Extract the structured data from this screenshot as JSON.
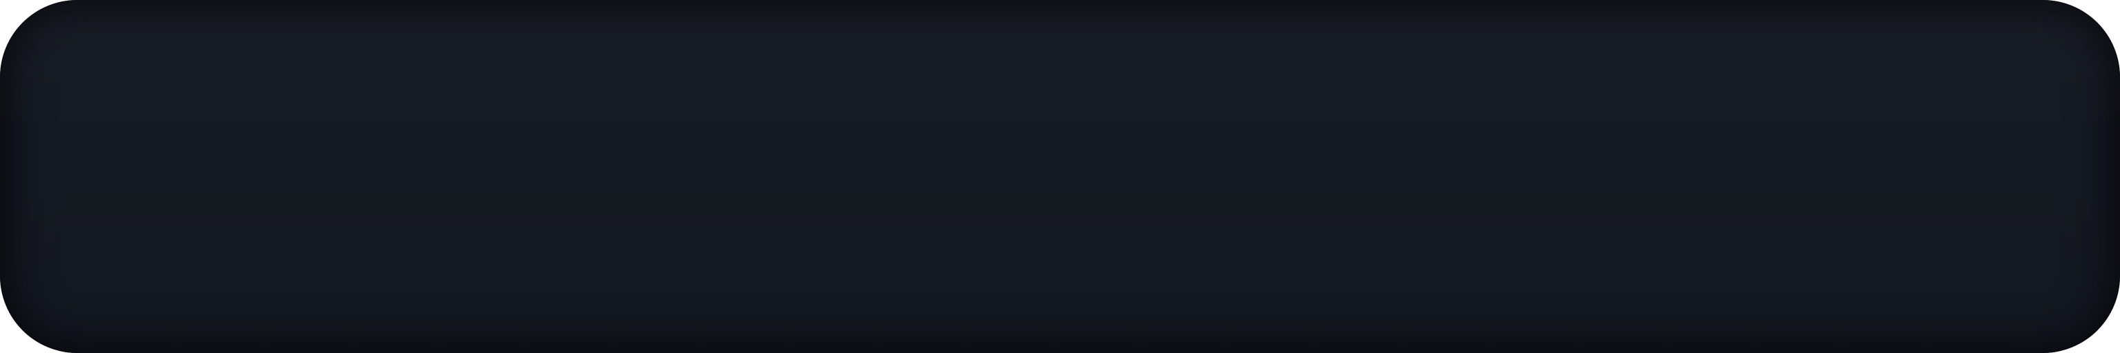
{
  "panel": {
    "background_color": "#151921",
    "edge_shadow_color": "#0b0d11"
  }
}
